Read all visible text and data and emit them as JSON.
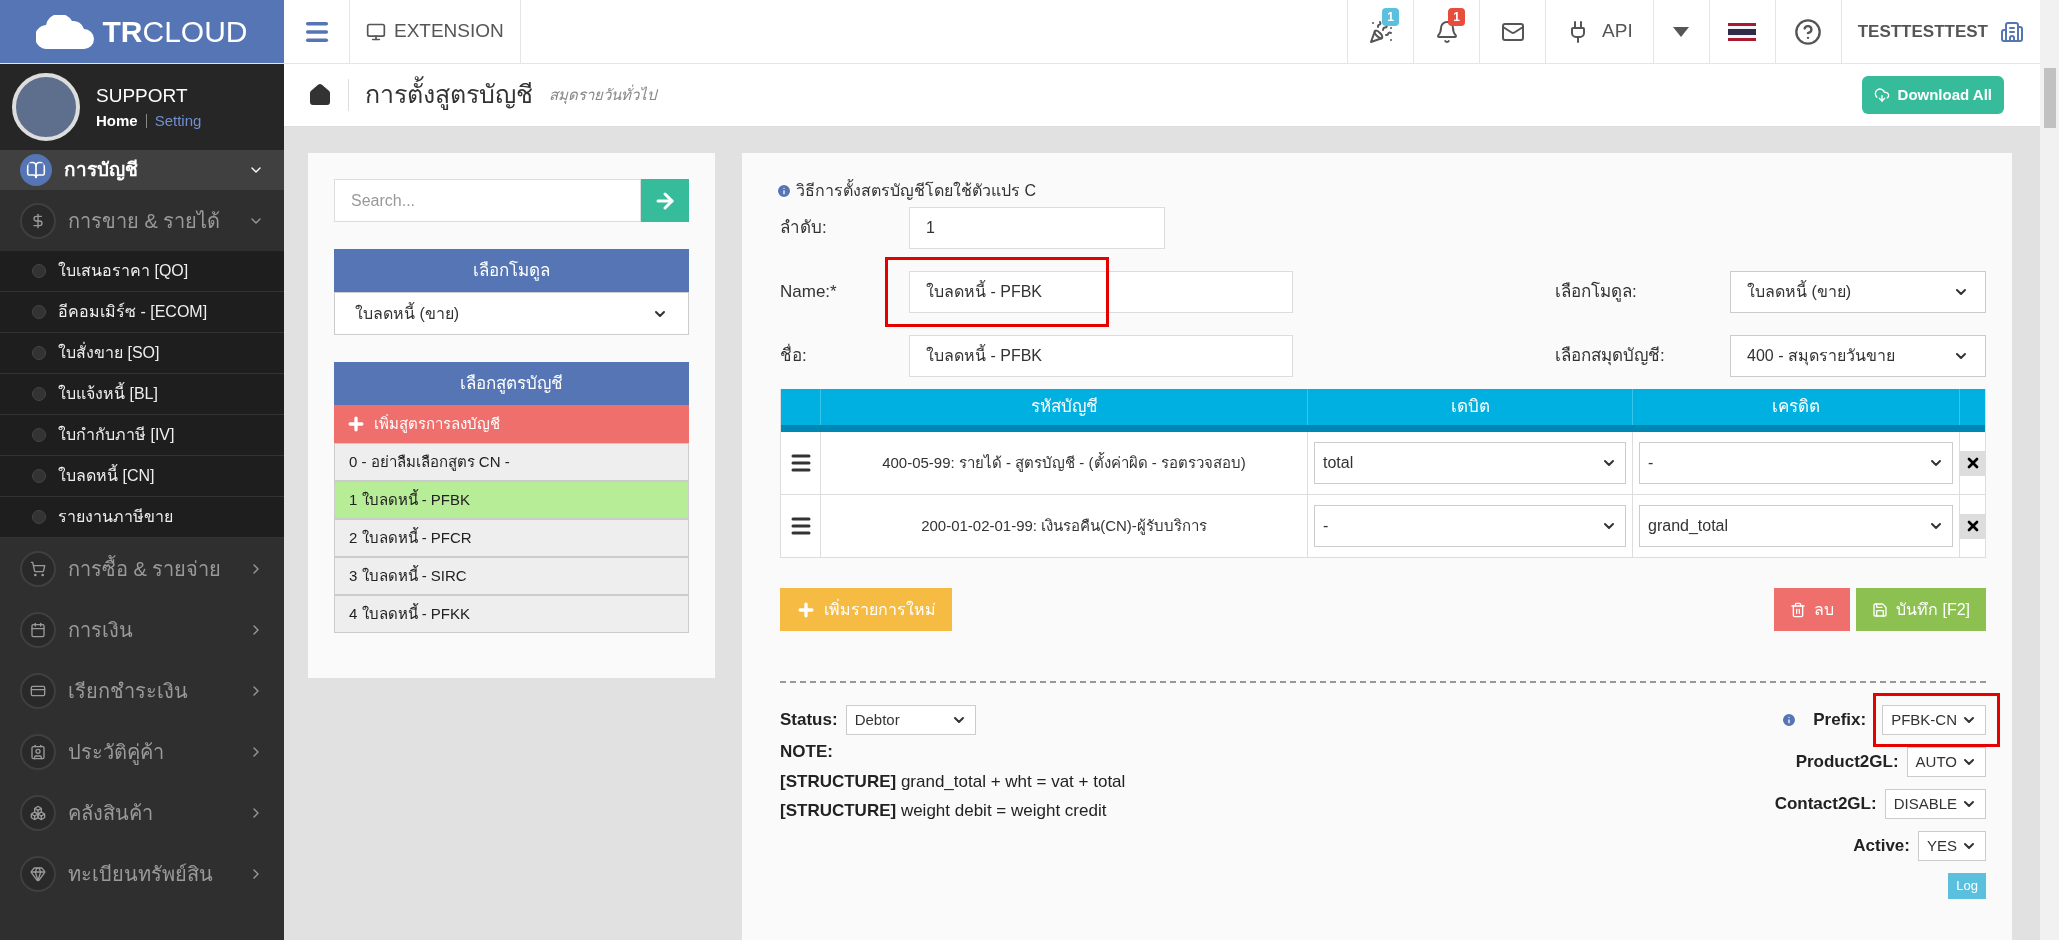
{
  "topbar": {
    "logo": "**TR**CLOUD",
    "extension": "EXTENSION",
    "notifications": [
      {
        "kind": "party",
        "badge": "1",
        "color": "#5bc0de"
      },
      {
        "kind": "bell",
        "badge": "1",
        "color": "#e74c3c"
      }
    ],
    "api": "API",
    "user": "TESTTESTTEST"
  },
  "profile": {
    "name": "SUPPORT",
    "links": [
      {
        "label": "Home",
        "selected": true
      },
      {
        "label": "Setting",
        "selected": false
      }
    ]
  },
  "sidebar": {
    "items": [
      {
        "label": "การบัญชี",
        "expanded": true,
        "selected": true,
        "children": [
          {
            "label": "การขาย & รายได้",
            "expanded": true,
            "children": [
              {
                "label": "ใบเสนอราคา [QO]"
              },
              {
                "label": "อีคอมเมิร์ซ - [ECOM]"
              },
              {
                "label": "ใบสั่งขาย [SO]"
              },
              {
                "label": "ใบแจ้งหนี้ [BL]"
              },
              {
                "label": "ใบกำกับภาษี [IV]"
              },
              {
                "label": "ใบลดหนี้ [CN]"
              },
              {
                "label": "รายงานภาษีขาย"
              }
            ]
          },
          {
            "label": "การซื้อ & รายจ่าย",
            "expanded": false
          },
          {
            "label": "การเงิน",
            "expanded": false
          },
          {
            "label": "เรียกชำระเงิน",
            "expanded": false
          },
          {
            "label": "ประวัติคู่ค้า",
            "expanded": false
          },
          {
            "label": "คลังสินค้า",
            "expanded": false
          },
          {
            "label": "ทะเบียนทรัพย์สิน",
            "expanded": false
          }
        ]
      }
    ]
  },
  "header": {
    "title": "การตั้งสูตรบัญชี",
    "subtitle": "สมุดรายวันทั่วไป",
    "download": "Download All"
  },
  "left_panel": {
    "search": {
      "placeholder": "Search..."
    },
    "module_title": "เลือกโมดูล",
    "module_value": "ใบลดหนี้ (ขาย)",
    "formula_title": "เลือกสูตรบัญชี",
    "add_formula": "เพิ่มสูตรการลงบัญชี",
    "formulas": [
      {
        "label": "0 - อย่าลืมเลือกสูตร CN -",
        "selected": false
      },
      {
        "label": "1 ใบลดหนี้ - PFBK",
        "selected": true
      },
      {
        "label": "2 ใบลดหนี้ - PFCR",
        "selected": false
      },
      {
        "label": "3 ใบลดหนี้ - SIRC",
        "selected": false
      },
      {
        "label": "4 ใบลดหนี้ - PFKK",
        "selected": false
      }
    ]
  },
  "form": {
    "info": "วิธีการตั้งสตรบัญชีโดยใช้ตัวแปร C",
    "order": {
      "label": "ลำดับ:",
      "value": "1"
    },
    "name": {
      "label": "Name:*",
      "value": "ใบลดหนี้ - PFBK",
      "highlighted": true
    },
    "name_th": {
      "label": "ชื่อ:",
      "value": "ใบลดหนี้ - PFBK"
    },
    "module": {
      "label": "เลือกโมดูล:",
      "value": "ใบลดหนี้ (ขาย)"
    },
    "journal": {
      "label": "เลือกสมุดบัญชี:",
      "value": "400 - สมุดรายวันขาย"
    },
    "table": {
      "columns": [
        "รหัสบัญชี",
        "เดบิต",
        "เครดิต"
      ],
      "rows": [
        {
          "account": "400-05-99: รายได้ - สูตรบัญชี - (ตั้งค่าผิด - รอตรวจสอบ)",
          "debit": "total",
          "credit": "-"
        },
        {
          "account": "200-01-02-01-99: เงินรอคืน(CN)-ผู้รับบริการ",
          "debit": "-",
          "credit": "grand_total"
        }
      ]
    },
    "add_row": "เพิ่มรายการใหม่",
    "delete": "ลบ",
    "save": "บันทึก [F2]",
    "status": {
      "label": "Status:",
      "value": "Debtor"
    },
    "note": "NOTE:",
    "structures": [
      "**[STRUCTURE]** grand_total + wht = vat + total",
      "**[STRUCTURE]** weight debit = weight credit"
    ],
    "options": [
      {
        "label": "Prefix:",
        "value": "PFBK-CN",
        "info": true,
        "highlighted": true
      },
      {
        "label": "Product2GL:",
        "value": "AUTO",
        "info": false,
        "highlighted": false
      },
      {
        "label": "Contact2GL:",
        "value": "DISABLE",
        "info": false,
        "highlighted": false
      },
      {
        "label": "Active:",
        "value": "YES",
        "info": false,
        "highlighted": false
      }
    ],
    "log": "Log"
  }
}
